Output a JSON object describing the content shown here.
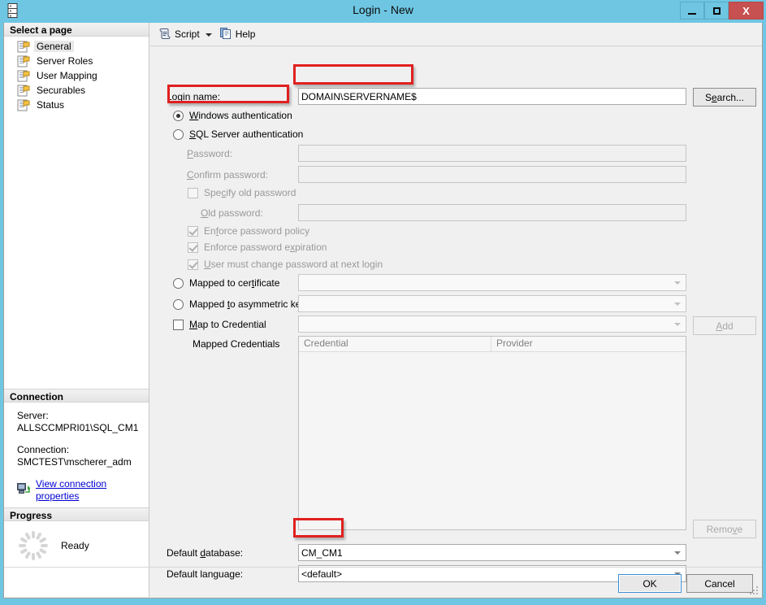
{
  "window": {
    "title": "Login - New",
    "icon": "server-icon",
    "minimize_label": "Minimize",
    "maximize_label": "Maximize",
    "close_label": "X"
  },
  "sidebar": {
    "header": "Select a page",
    "items": [
      {
        "label": "General",
        "selected": true
      },
      {
        "label": "Server Roles",
        "selected": false
      },
      {
        "label": "User Mapping",
        "selected": false
      },
      {
        "label": "Securables",
        "selected": false
      },
      {
        "label": "Status",
        "selected": false
      }
    ],
    "connection": {
      "header": "Connection",
      "server_label": "Server:",
      "server_value": "ALLSCCMPRI01\\SQL_CM1",
      "connection_label": "Connection:",
      "connection_value": "SMCTEST\\mscherer_adm",
      "link": "View connection properties",
      "link_icon": "connection-properties-icon"
    },
    "progress": {
      "header": "Progress",
      "status": "Ready",
      "spinner_icon": "progress-spinner-icon"
    }
  },
  "toolbar": {
    "script_label": "Script",
    "script_icon": "script-icon",
    "dropdown_icon": "chevron-down-icon",
    "help_label": "Help",
    "help_icon": "help-icon"
  },
  "form": {
    "login_name_label": "Login name:",
    "login_name_value": "DOMAIN\\SERVERNAME$",
    "search_button": "Search...",
    "windows_auth_label": "Windows authentication",
    "windows_auth_checked": true,
    "sql_auth_label": "SQL Server authentication",
    "sql_auth_checked": false,
    "password_label": "Password:",
    "password_value": "",
    "confirm_password_label": "Confirm password:",
    "confirm_password_value": "",
    "specify_old_password_label": "Specify old password",
    "specify_old_password_checked": false,
    "old_password_label": "Old password:",
    "old_password_value": "",
    "enforce_policy_label": "Enforce password policy",
    "enforce_policy_checked": true,
    "enforce_expiration_label": "Enforce password expiration",
    "enforce_expiration_checked": true,
    "must_change_label": "User must change password at next login",
    "must_change_checked": true,
    "mapped_certificate_label": "Mapped to certificate",
    "mapped_certificate_checked": false,
    "mapped_certificate_value": "",
    "mapped_asymmetric_label": "Mapped to asymmetric key",
    "mapped_asymmetric_checked": false,
    "mapped_asymmetric_value": "",
    "map_credential_label": "Map to Credential",
    "map_credential_checked": false,
    "map_credential_value": "",
    "add_button": "Add",
    "remove_button": "Remove",
    "mapped_credentials_label": "Mapped Credentials",
    "credentials_columns": [
      "Credential",
      "Provider"
    ],
    "credentials_rows": [],
    "default_database_label": "Default database:",
    "default_database_value": "CM_CM1",
    "default_language_label": "Default language:",
    "default_language_value": "<default>"
  },
  "footer": {
    "ok_button": "OK",
    "cancel_button": "Cancel"
  },
  "annotations": {
    "highlight_color": "#e02020",
    "boxes": [
      {
        "target": "login-name-input",
        "note": "login name highlighted"
      },
      {
        "target": "windows-authentication-radio",
        "note": "windows auth highlighted"
      },
      {
        "target": "default-database-combo",
        "note": "default database highlighted"
      }
    ]
  }
}
